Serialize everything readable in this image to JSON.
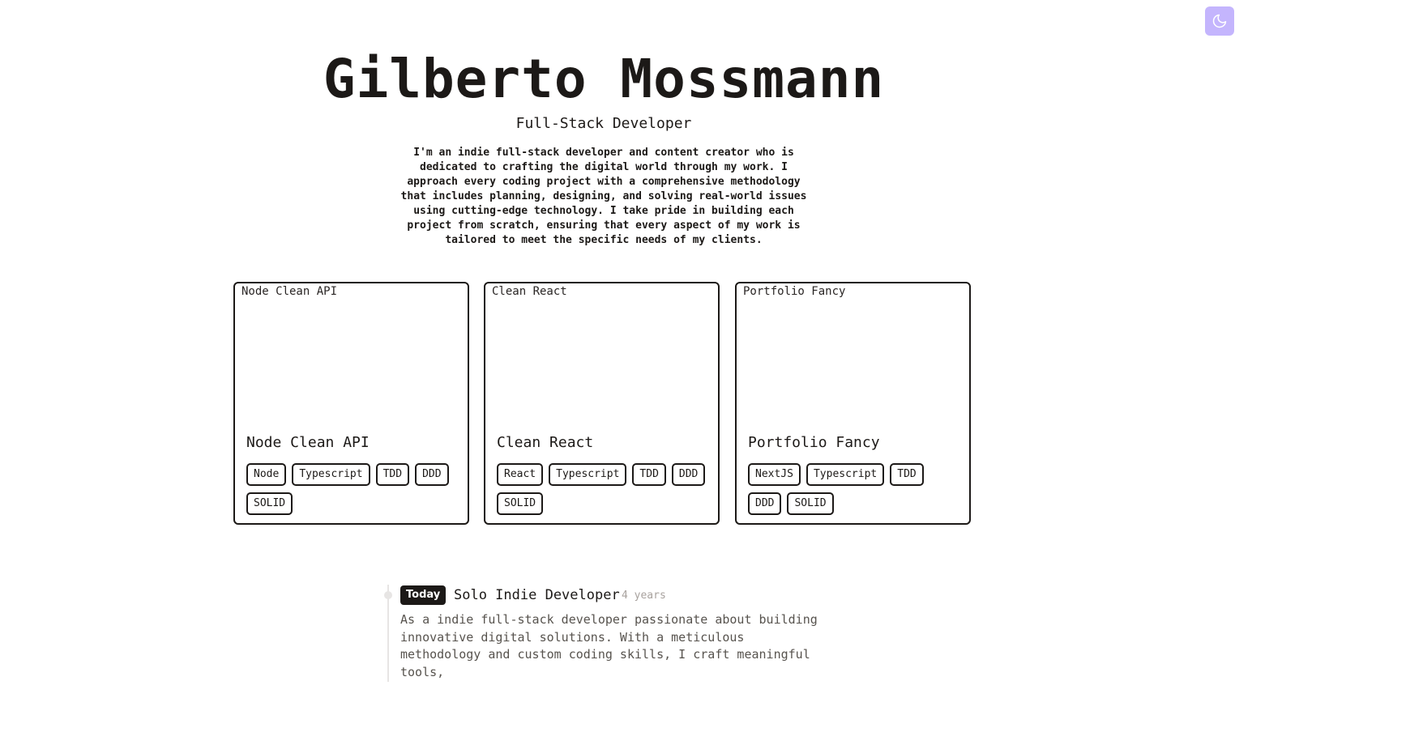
{
  "theme_toggle": {
    "icon": "moon-icon",
    "color": "#c4b5fd"
  },
  "hero": {
    "name": "Gilberto Mossmann",
    "subtitle": "Full-Stack Developer",
    "bio": "I'm an indie full-stack developer and content creator who is dedicated to crafting the digital world through my work. I approach every coding project with a comprehensive methodology that includes planning, designing, and solving real-world issues using cutting-edge technology. I take pride in building each project from scratch, ensuring that every aspect of my work is tailored to meet the specific needs of my clients."
  },
  "projects": [
    {
      "image_alt": "Node Clean API",
      "title": "Node Clean API",
      "tags": [
        "Node",
        "Typescript",
        "TDD",
        "DDD",
        "SOLID"
      ]
    },
    {
      "image_alt": "Clean React",
      "title": "Clean React",
      "tags": [
        "React",
        "Typescript",
        "TDD",
        "DDD",
        "SOLID"
      ]
    },
    {
      "image_alt": "Portfolio Fancy",
      "title": "Portfolio Fancy",
      "tags": [
        "NextJS",
        "Typescript",
        "TDD",
        "DDD",
        "SOLID"
      ]
    }
  ],
  "timeline": {
    "badge": "Today",
    "role": "Solo Indie Developer",
    "duration": "4 years",
    "description": "As a indie full-stack developer passionate about building innovative digital solutions. With a meticulous methodology and custom coding skills, I craft meaningful tools,"
  }
}
